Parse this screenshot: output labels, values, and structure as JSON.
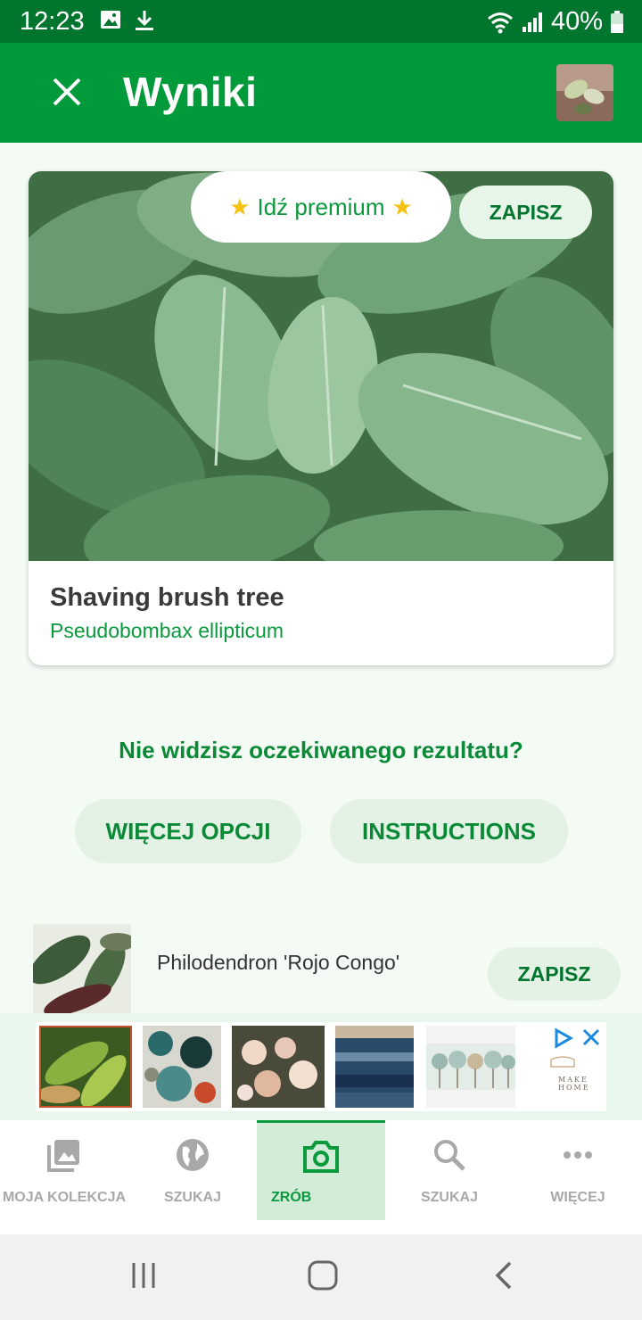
{
  "status_bar": {
    "time": "12:23",
    "battery": "40%"
  },
  "app_bar": {
    "title": "Wyniki"
  },
  "result": {
    "premium_label": "Idź premium",
    "save_label": "ZAPISZ",
    "common_name": "Shaving brush tree",
    "latin_name": "Pseudobombax ellipticum"
  },
  "help": {
    "question": "Nie widzisz oczekiwanego rezultatu?",
    "more_options": "WIĘCEJ OPCJI",
    "instructions": "INSTRUCTIONS"
  },
  "alternate": {
    "name": "Philodendron 'Rojo Congo'",
    "save_label": "ZAPISZ"
  },
  "ad": {
    "brand": "MAKE HOME"
  },
  "bottom_nav": [
    {
      "label": "MOJA KOLEKCJA",
      "icon": "gallery-icon"
    },
    {
      "label": "SZUKAJ",
      "icon": "globe-icon"
    },
    {
      "label": "ZRÓB",
      "icon": "camera-icon",
      "active": true
    },
    {
      "label": "SZUKAJ",
      "icon": "search-icon"
    },
    {
      "label": "WIĘCEJ",
      "icon": "more-icon"
    }
  ],
  "colors": {
    "primary": "#009a3a",
    "primary_dark": "#00752e",
    "accent_text": "#0a9a3d",
    "chip_bg": "#e3f2e5"
  }
}
